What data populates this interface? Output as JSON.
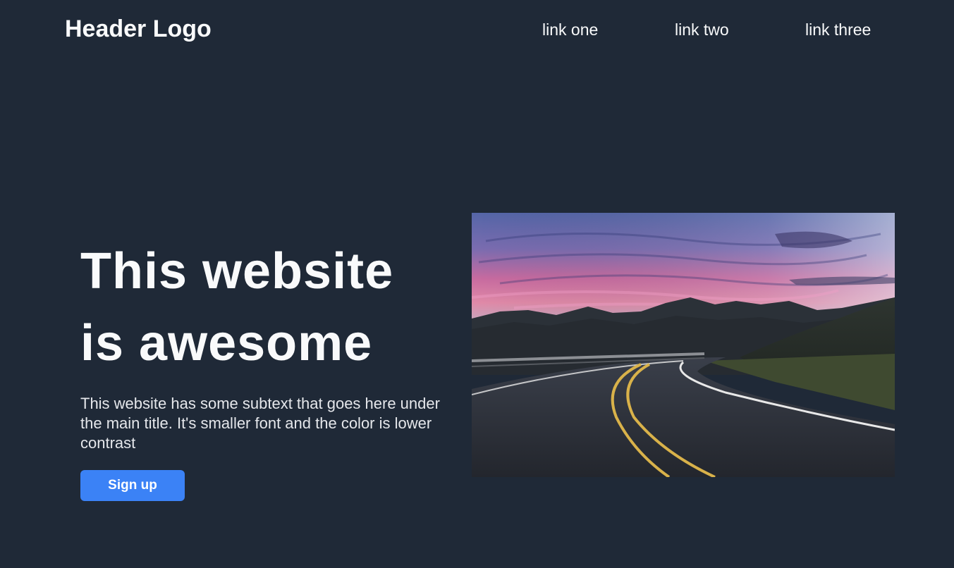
{
  "header": {
    "logo": "Header Logo",
    "nav": [
      {
        "label": "link one"
      },
      {
        "label": "link two"
      },
      {
        "label": "link three"
      }
    ]
  },
  "hero": {
    "title_line1": "This website",
    "title_line2": "is awesome",
    "subtext": "This website has some subtext that goes here under the main title. It's smaller font and the color is lower contrast",
    "cta_label": "Sign up"
  },
  "colors": {
    "background": "#1f2937",
    "text_primary": "#f9fafb",
    "text_secondary": "#e5e7eb",
    "accent": "#3b82f6"
  },
  "image": {
    "subject": "mountain-road-sunset-photo"
  }
}
